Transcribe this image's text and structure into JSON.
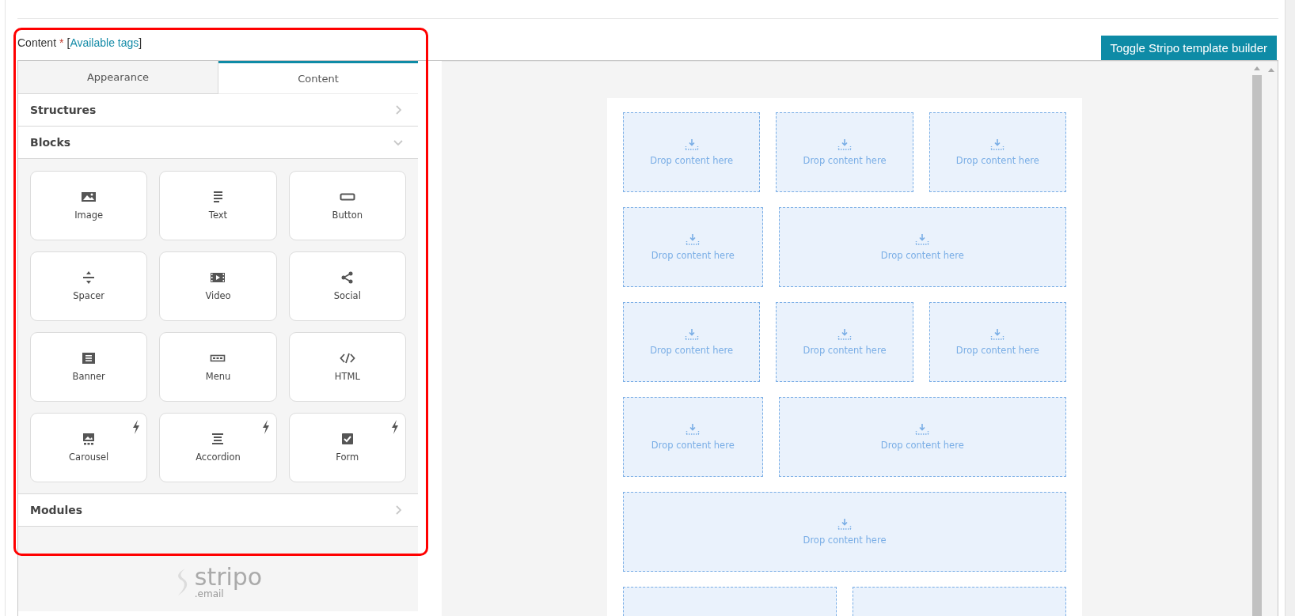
{
  "field": {
    "label": "Content",
    "required_mark": "*",
    "link_open": "[",
    "link": "Available tags",
    "link_close": "]"
  },
  "toggle_button": "Toggle Stripo template builder",
  "tabs": [
    {
      "label": "Appearance",
      "selected": false
    },
    {
      "label": "Content",
      "selected": true
    }
  ],
  "sections": [
    {
      "title": "Structures",
      "expanded": false
    },
    {
      "title": "Blocks",
      "expanded": true,
      "blocks": [
        {
          "label": "Image",
          "kind": "image",
          "amp": false
        },
        {
          "label": "Text",
          "kind": "text",
          "amp": false
        },
        {
          "label": "Button",
          "kind": "button",
          "amp": false
        },
        {
          "label": "Spacer",
          "kind": "spacer",
          "amp": false
        },
        {
          "label": "Video",
          "kind": "video",
          "amp": false
        },
        {
          "label": "Social",
          "kind": "social",
          "amp": false
        },
        {
          "label": "Banner",
          "kind": "banner",
          "amp": false
        },
        {
          "label": "Menu",
          "kind": "menu",
          "amp": false
        },
        {
          "label": "HTML",
          "kind": "html",
          "amp": false
        },
        {
          "label": "Carousel",
          "kind": "carousel",
          "amp": true
        },
        {
          "label": "Accordion",
          "kind": "accordion",
          "amp": true
        },
        {
          "label": "Form",
          "kind": "form",
          "amp": true
        }
      ]
    },
    {
      "title": "Modules",
      "expanded": false
    }
  ],
  "logo": {
    "name": "stripo",
    "suffix": ".email"
  },
  "drop_rows": [
    {
      "cells": [
        {
          "kind": "third",
          "text": "Drop content here"
        },
        {
          "kind": "third",
          "text": "Drop content here"
        },
        {
          "kind": "third",
          "text": "Drop content here"
        }
      ]
    },
    {
      "cells": [
        {
          "kind": "third",
          "text": "Drop content here"
        },
        {
          "kind": "two-thirds",
          "text": "Drop content here"
        }
      ]
    },
    {
      "cells": [
        {
          "kind": "third",
          "text": "Drop content here"
        },
        {
          "kind": "third",
          "text": "Drop content here"
        },
        {
          "kind": "third",
          "text": "Drop content here"
        }
      ]
    },
    {
      "cells": [
        {
          "kind": "third",
          "text": "Drop content here"
        },
        {
          "kind": "two-thirds",
          "text": "Drop content here"
        }
      ]
    },
    {
      "cells": [
        {
          "kind": "full",
          "text": "Drop content here"
        }
      ]
    },
    {
      "cells": [
        {
          "kind": "half"
        },
        {
          "kind": "half"
        }
      ]
    }
  ]
}
